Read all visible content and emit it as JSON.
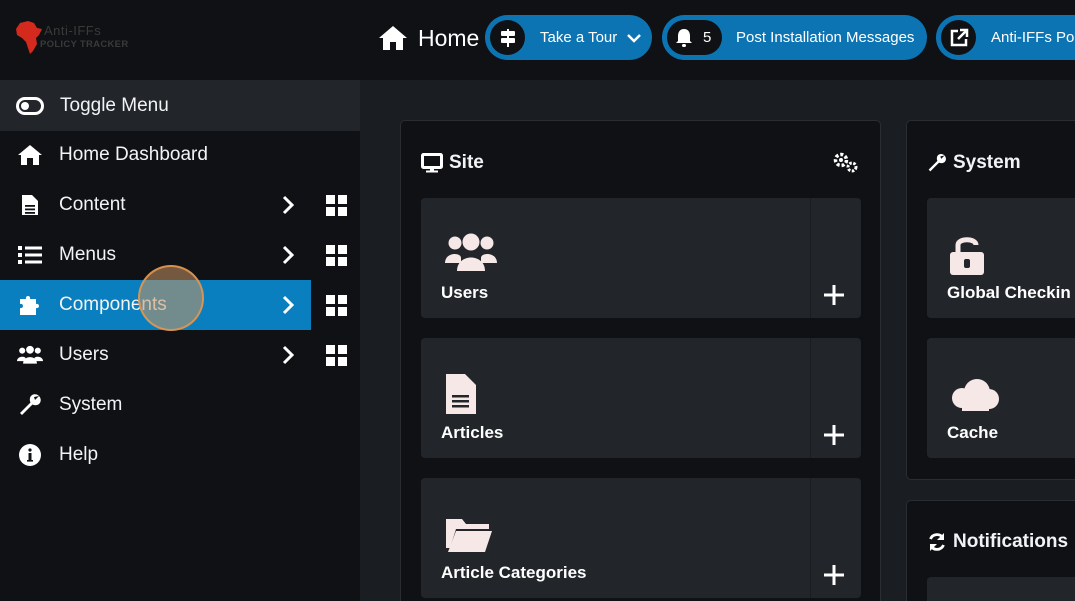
{
  "header": {
    "logo_line1": "Anti-IFFs",
    "logo_line2": "POLICY TRACKER",
    "title": "Home",
    "tour_label": "Take a Tour",
    "messages_count": "5",
    "messages_label": "Post Installation Messages",
    "site_label": "Anti-IFFs Poli"
  },
  "sidebar": {
    "toggle_label": "Toggle Menu",
    "items": [
      {
        "label": "Home Dashboard",
        "icon": "home-icon"
      },
      {
        "label": "Content",
        "icon": "file-icon"
      },
      {
        "label": "Menus",
        "icon": "list-icon"
      },
      {
        "label": "Components",
        "icon": "puzzle-icon",
        "active": true
      },
      {
        "label": "Users",
        "icon": "users-icon"
      },
      {
        "label": "System",
        "icon": "wrench-icon"
      },
      {
        "label": "Help",
        "icon": "info-icon"
      }
    ]
  },
  "main": {
    "site": {
      "title": "Site",
      "tiles": [
        {
          "label": "Users",
          "icon": "users-icon"
        },
        {
          "label": "Articles",
          "icon": "file-icon"
        },
        {
          "label": "Article Categories",
          "icon": "folder-open-icon"
        }
      ]
    },
    "system": {
      "title": "System",
      "tiles": [
        {
          "label": "Global Checkin",
          "icon": "unlock-icon"
        },
        {
          "label": "Cache",
          "icon": "cloud-icon"
        }
      ]
    },
    "notifications": {
      "title": "Notifications"
    }
  },
  "colors": {
    "accent": "#0d74b4",
    "active_nav": "#0a7fbf",
    "background": "#1a1d21",
    "panel": "#0f1114",
    "tile": "#22262b"
  }
}
